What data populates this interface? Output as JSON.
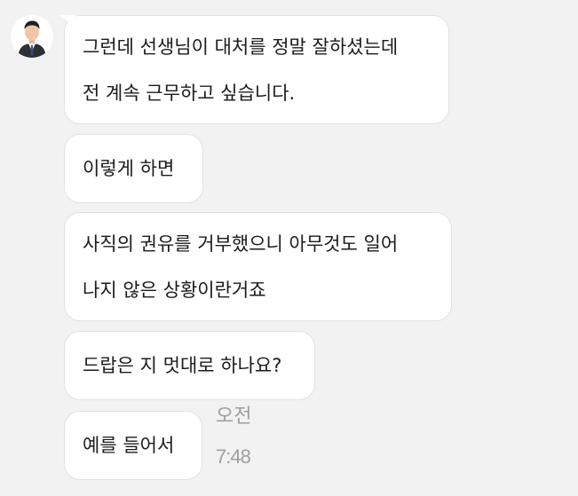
{
  "messages": [
    {
      "lines": [
        "그런데 선생님이 대처를 정말 잘하셨는데",
        "전 계속 근무하고 싶습니다."
      ]
    },
    {
      "lines": [
        "이렇게 하면"
      ]
    },
    {
      "lines": [
        "사직의 권유를 거부했으니 아무것도 일어",
        "나지 않은 상황이란거죠"
      ]
    },
    {
      "lines": [
        "드랍은 지 멋대로 하나요?"
      ]
    },
    {
      "lines": [
        "예를 들어서"
      ]
    }
  ],
  "meta": {
    "ampm": "오전",
    "time": "7:48"
  },
  "colors": {
    "background": "#f2f2f2",
    "bubble": "#ffffff",
    "text": "#1b1b1b",
    "meta": "#9e9e9e"
  },
  "icons": {
    "avatar": "person-avatar-icon"
  }
}
